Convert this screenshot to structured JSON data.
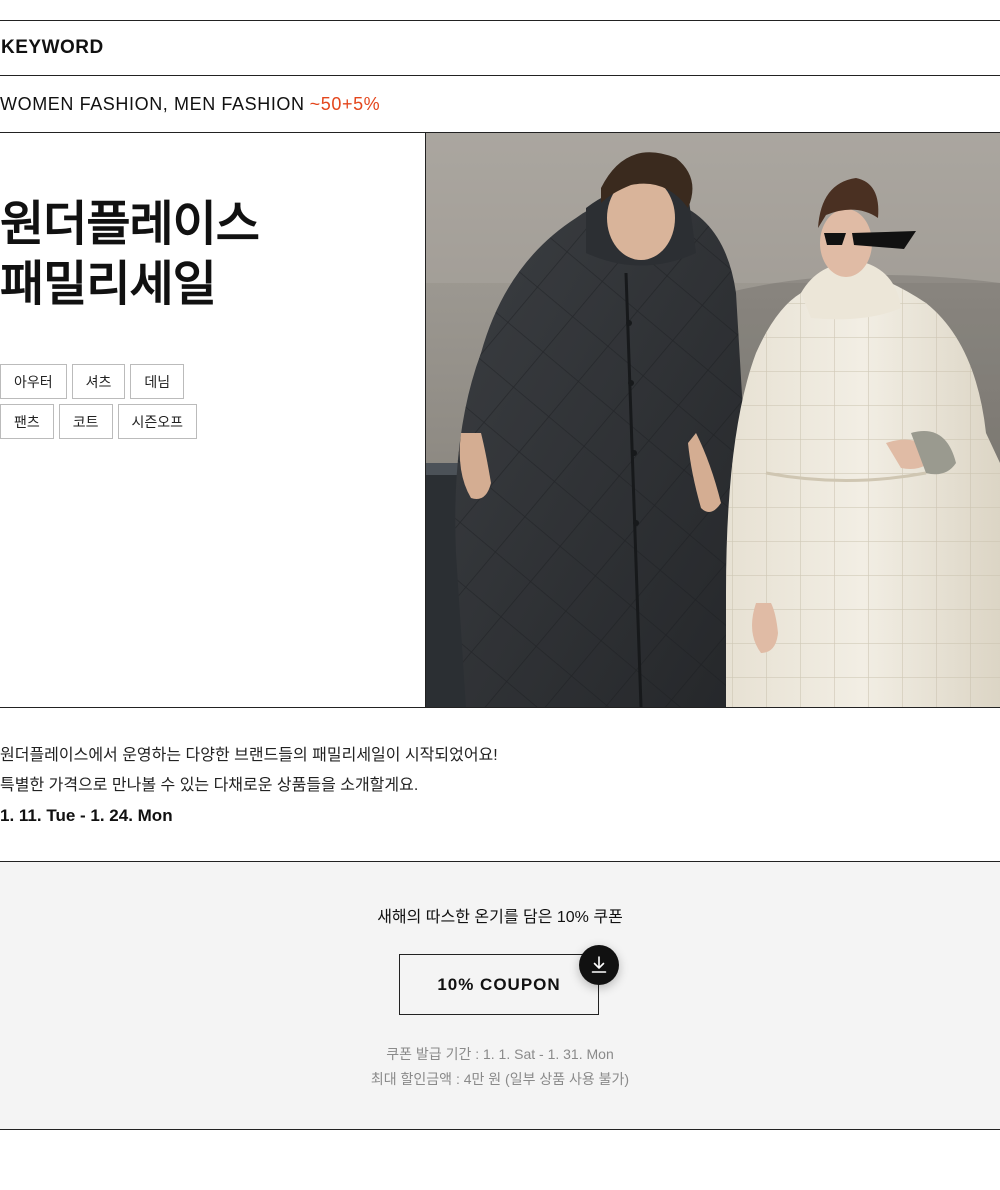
{
  "keyword": {
    "title": "KEYWORD"
  },
  "category": {
    "text": "WOMEN FASHION, MEN FASHION",
    "discount": "~50+5%"
  },
  "hero": {
    "title_line1": "원더플레이스",
    "title_line2": "패밀리세일",
    "tags_row1": [
      "아우터",
      "셔츠",
      "데님"
    ],
    "tags_row2": [
      "팬츠",
      "코트",
      "시즌오프"
    ]
  },
  "description": {
    "line1": "원더플레이스에서 운영하는 다양한 브랜드들의 패밀리세일이 시작되었어요!",
    "line2": "특별한 가격으로 만나볼 수 있는 다채로운 상품들을 소개할게요.",
    "date": "1. 11. Tue - 1. 24. Mon"
  },
  "coupon": {
    "heading": "새해의 따스한 온기를 담은 10% 쿠폰",
    "button_label": "10% COUPON",
    "download_icon": "download-icon",
    "period": "쿠폰 발급 기간 : 1. 1. Sat - 1. 31. Mon",
    "max_discount": "최대 할인금액 : 4만 원 (일부 상품 사용 불가)"
  },
  "colors": {
    "accent": "#e4461c",
    "text": "#111111",
    "muted": "#8a8a8a",
    "coupon_bg": "#f4f4f4"
  }
}
